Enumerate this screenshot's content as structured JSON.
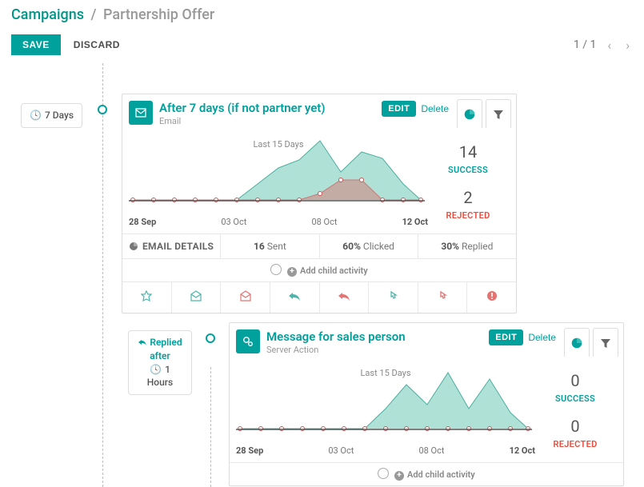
{
  "breadcrumb": {
    "root": "Campaigns",
    "current": "Partnership Offer"
  },
  "toolbar": {
    "save": "SAVE",
    "discard": "DISCARD"
  },
  "pager": {
    "pos": "1",
    "total": "1"
  },
  "pills": {
    "days7": "7 Days",
    "replied": "Replied after",
    "hours1": "1 Hours"
  },
  "card1": {
    "title": "After 7 days (if not partner yet)",
    "type": "Email",
    "edit": "EDIT",
    "delete": "Delete",
    "chart_label": "Last 15 Days",
    "success_n": "14",
    "success_l": "SUCCESS",
    "rejected_n": "2",
    "rejected_l": "REJECTED",
    "ticks": {
      "a": "28 Sep",
      "b": "03 Oct",
      "c": "08 Oct",
      "d": "12 Oct"
    },
    "details_label": "EMAIL DETAILS",
    "sent_n": "16",
    "sent_l": "Sent",
    "clicked_n": "60%",
    "clicked_l": "Clicked",
    "replied_n": "30%",
    "replied_l": "Replied",
    "add_child": "Add child activity"
  },
  "card2": {
    "title": "Message for sales person",
    "type": "Server Action",
    "edit": "EDIT",
    "delete": "Delete",
    "chart_label": "Last 15 Days",
    "success_n": "0",
    "success_l": "SUCCESS",
    "rejected_n": "0",
    "rejected_l": "REJECTED",
    "ticks": {
      "a": "28 Sep",
      "b": "03 Oct",
      "c": "08 Oct",
      "d": "12 Oct"
    },
    "add_child": "Add child activity"
  },
  "chart_data": [
    {
      "type": "area",
      "title": "Last 15 Days",
      "x": [
        "28 Sep",
        "29 Sep",
        "30 Sep",
        "01 Oct",
        "02 Oct",
        "03 Oct",
        "04 Oct",
        "05 Oct",
        "06 Oct",
        "07 Oct",
        "08 Oct",
        "09 Oct",
        "10 Oct",
        "11 Oct",
        "12 Oct"
      ],
      "series": [
        {
          "name": "Success",
          "values": [
            0,
            0,
            0,
            0,
            0,
            0,
            2,
            4,
            5,
            8,
            4,
            7,
            6,
            2,
            0
          ]
        },
        {
          "name": "Rejected",
          "values": [
            0,
            0,
            0,
            0,
            0,
            0,
            0,
            0,
            0,
            1,
            2,
            2,
            0,
            0,
            0
          ]
        }
      ],
      "xlabel": "",
      "ylabel": ""
    },
    {
      "type": "area",
      "title": "Last 15 Days",
      "x": [
        "28 Sep",
        "29 Sep",
        "30 Sep",
        "01 Oct",
        "02 Oct",
        "03 Oct",
        "04 Oct",
        "05 Oct",
        "06 Oct",
        "07 Oct",
        "08 Oct",
        "09 Oct",
        "10 Oct",
        "11 Oct",
        "12 Oct"
      ],
      "series": [
        {
          "name": "Success",
          "values": [
            0,
            0,
            0,
            0,
            0,
            0,
            0,
            3,
            6,
            4,
            8,
            3,
            7,
            2,
            0
          ]
        },
        {
          "name": "Rejected",
          "values": [
            0,
            0,
            0,
            0,
            0,
            0,
            0,
            0,
            0,
            0,
            0,
            0,
            0,
            0,
            0
          ]
        }
      ],
      "xlabel": "",
      "ylabel": ""
    }
  ]
}
